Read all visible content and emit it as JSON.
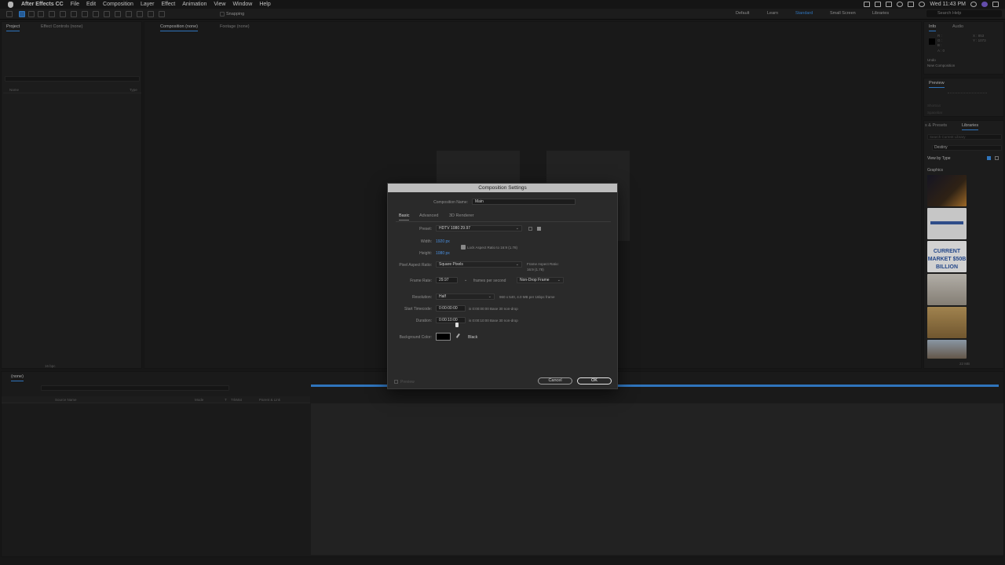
{
  "menubar": {
    "app_name": "After Effects CC",
    "items": [
      "File",
      "Edit",
      "Composition",
      "Layer",
      "Effect",
      "Animation",
      "View",
      "Window",
      "Help"
    ],
    "clock": "Wed 11:43 PM"
  },
  "toolbar": {
    "snapping_label": "Snapping",
    "workspaces": [
      "Default",
      "Learn",
      "Standard",
      "Small Screen",
      "Libraries"
    ],
    "active_workspace": "Standard",
    "search_placeholder": "Search Help"
  },
  "project_panel": {
    "tabs": [
      "Project",
      "Effect Controls (none)"
    ],
    "columns": [
      "Name",
      "Type"
    ],
    "bpc_label": "16 bpc"
  },
  "viewer": {
    "tabs": [
      "Composition (none)",
      "Footage (none)"
    ]
  },
  "info_panel": {
    "tabs": [
      "Info",
      "Audio"
    ],
    "channels": [
      "R :",
      "G :",
      "B :",
      "A : 0"
    ],
    "x_readout": "X : 853",
    "y_readout": "Y : 1073",
    "history": [
      "Undo",
      "New Composition"
    ]
  },
  "preview_panel": {
    "title": "Preview",
    "shortcut_label": "Shortcut",
    "shortcut_value": "Spacebar"
  },
  "libraries_panel": {
    "tabs": [
      "s & Presets",
      "Libraries"
    ],
    "search_placeholder": "Search Current Library",
    "library_name": "Destiny",
    "view_by": "View by Type",
    "section": "Graphics",
    "thumb_texts": [
      "CURRENT MARKET $50B BILLION"
    ],
    "size_label": "22 MB"
  },
  "timeline": {
    "tab": "(none)",
    "columns": [
      "Source Name",
      "Mode",
      "T",
      "TrkMat",
      "Parent & Link"
    ]
  },
  "dialog": {
    "title": "Composition Settings",
    "comp_name_label": "Composition Name:",
    "comp_name": "Main",
    "tabs": [
      "Basic",
      "Advanced",
      "3D Renderer"
    ],
    "active_tab": "Basic",
    "preset_label": "Preset:",
    "preset": "HDTV 1080 29.97",
    "width_label": "Width:",
    "width": "1920 px",
    "height_label": "Height:",
    "height": "1080 px",
    "lock_aspect": "Lock Aspect Ratio to 16:9 (1.78)",
    "par_label": "Pixel Aspect Ratio:",
    "par": "Square Pixels",
    "frame_aspect_label": "Frame Aspect Ratio:",
    "frame_aspect": "16:9 (1.78)",
    "frame_rate_label": "Frame Rate:",
    "frame_rate": "29.97",
    "fps_label": "frames per second",
    "drop_frame": "Non-Drop Frame",
    "resolution_label": "Resolution:",
    "resolution": "Half",
    "resolution_info": "960 x 540, 4.0 MB per 16bpc frame",
    "start_tc_label": "Start Timecode:",
    "start_tc": "0:00:00:00",
    "start_tc_info": "is 0:00:00:00  Base 30  non-drop",
    "duration_label": "Duration:",
    "duration": "0:00:10:00",
    "duration_info": "is 0:00:10:00  Base 30  non-drop",
    "bg_color_label": "Background Color:",
    "bg_color_name": "Black",
    "preview_label": "Preview",
    "cancel": "Cancel",
    "ok": "OK"
  },
  "colors": {
    "accent": "#3a8ee6",
    "panel_bg": "#232323",
    "dialog_bg": "#2a2a2a"
  }
}
